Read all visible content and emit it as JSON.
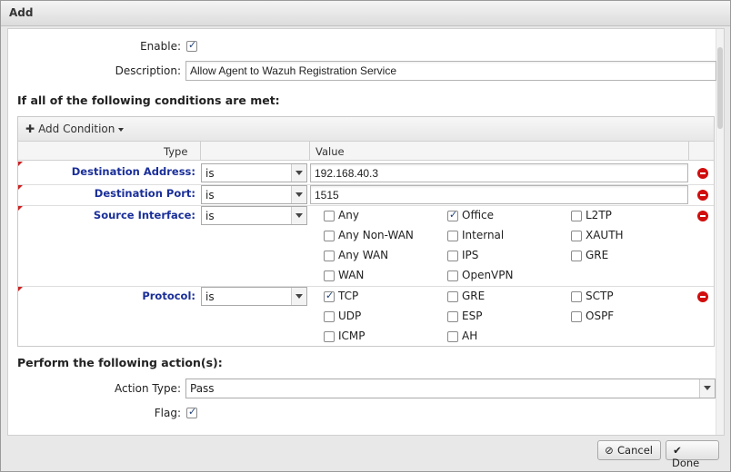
{
  "dialog": {
    "title": "Add"
  },
  "form": {
    "enable_label": "Enable:",
    "enable_checked": true,
    "description_label": "Description:",
    "description_value": "Allow Agent to Wazuh Registration Service"
  },
  "conditions": {
    "heading": "If all of the following conditions are met:",
    "add_condition_label": "Add Condition",
    "columns": {
      "type": "Type",
      "value": "Value"
    },
    "rows": [
      {
        "label": "Destination Address:",
        "operator": "is",
        "value": "192.168.40.3"
      },
      {
        "label": "Destination Port:",
        "operator": "is",
        "value": "1515"
      },
      {
        "label": "Source Interface:",
        "operator": "is",
        "options": [
          {
            "label": "Any",
            "checked": false
          },
          {
            "label": "Office",
            "checked": true
          },
          {
            "label": "L2TP",
            "checked": false
          },
          {
            "label": "Any Non-WAN",
            "checked": false
          },
          {
            "label": "Internal",
            "checked": false
          },
          {
            "label": "XAUTH",
            "checked": false
          },
          {
            "label": "Any WAN",
            "checked": false
          },
          {
            "label": "IPS",
            "checked": false
          },
          {
            "label": "GRE",
            "checked": false
          },
          {
            "label": "WAN",
            "checked": false
          },
          {
            "label": "OpenVPN",
            "checked": false
          }
        ]
      },
      {
        "label": "Protocol:",
        "operator": "is",
        "options": [
          {
            "label": "TCP",
            "checked": true
          },
          {
            "label": "GRE",
            "checked": false
          },
          {
            "label": "SCTP",
            "checked": false
          },
          {
            "label": "UDP",
            "checked": false
          },
          {
            "label": "ESP",
            "checked": false
          },
          {
            "label": "OSPF",
            "checked": false
          },
          {
            "label": "ICMP",
            "checked": false
          },
          {
            "label": "AH",
            "checked": false
          }
        ]
      }
    ]
  },
  "actions": {
    "heading": "Perform the following action(s):",
    "action_type_label": "Action Type:",
    "action_type_value": "Pass",
    "flag_label": "Flag:",
    "flag_checked": true
  },
  "footer": {
    "cancel_label": "Cancel",
    "done_label": "Done"
  },
  "colors": {
    "condition_label": "#1a2f9a",
    "remove_icon": "#d10d0d",
    "checkmark": "#1f3f7a"
  },
  "icons": {
    "remove": "minus-circle-icon",
    "add": "plus-icon",
    "cancel": "cancel-circle-icon",
    "done": "checkmark-icon"
  }
}
